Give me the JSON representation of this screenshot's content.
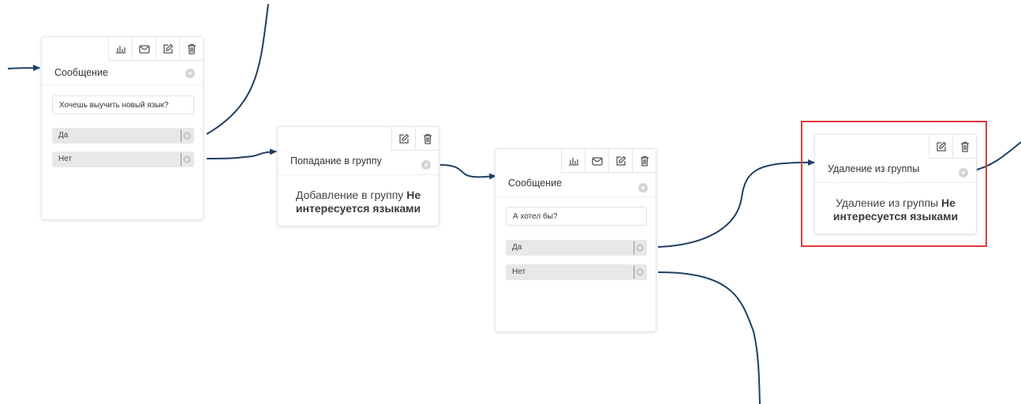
{
  "toolbar_icons": [
    "stats-icon",
    "mail-icon",
    "edit-icon",
    "trash-icon"
  ],
  "colors": {
    "connector": "#1f3f62",
    "highlight": "#e03b3b",
    "node_border": "#e4e6ea"
  },
  "nodes": {
    "message1": {
      "title": "Сообщение",
      "text": "Хочешь выучить новый язык?",
      "answers": [
        "Да",
        "Нет"
      ]
    },
    "add_group": {
      "title": "Попадание в группу",
      "body_prefix": "Добавление в группу",
      "body_bold": "Не интересуется языками"
    },
    "message2": {
      "title": "Сообщение",
      "text": "А хотел бы?",
      "answers": [
        "Да",
        "Нет"
      ]
    },
    "remove_group": {
      "title": "Удаление из группы",
      "body_prefix": "Удаление из группы",
      "body_bold": "Не интересуется языками"
    }
  }
}
